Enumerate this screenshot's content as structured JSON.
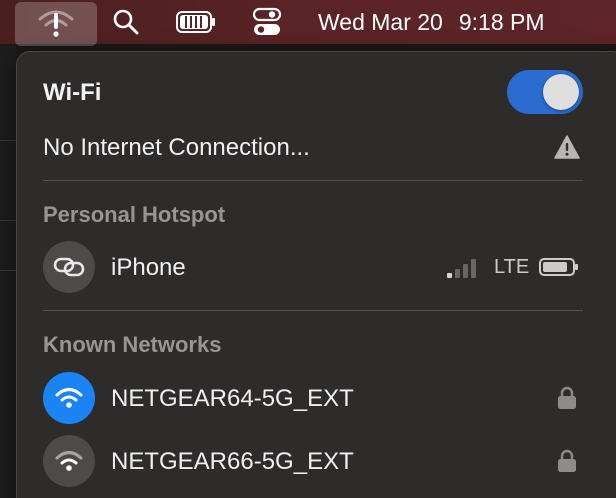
{
  "menubar": {
    "icons": [
      "wifi-exclamation-icon",
      "search-icon",
      "battery-icon",
      "control-center-icon"
    ],
    "date": "Wed Mar 20",
    "time": "9:18 PM"
  },
  "wifi_panel": {
    "title": "Wi-Fi",
    "toggle_on": true,
    "status": "No Internet Connection...",
    "status_icon": "warning-icon",
    "accent_color": "#2a6cd0"
  },
  "personal_hotspot": {
    "header": "Personal Hotspot",
    "devices": [
      {
        "name": "iPhone",
        "icon": "hotspot-link-icon",
        "network_type": "LTE",
        "signal_bars": 1,
        "battery_icon": "battery-icon"
      }
    ]
  },
  "known_networks": {
    "header": "Known Networks",
    "networks": [
      {
        "name": "NETGEAR64-5G_EXT",
        "icon": "wifi-icon",
        "connected": true,
        "icon_color": "#1a84f5",
        "secured": true
      },
      {
        "name": "NETGEAR66-5G_EXT",
        "icon": "wifi-icon",
        "connected": false,
        "icon_color": "#4e4a4a",
        "secured": true
      }
    ]
  }
}
